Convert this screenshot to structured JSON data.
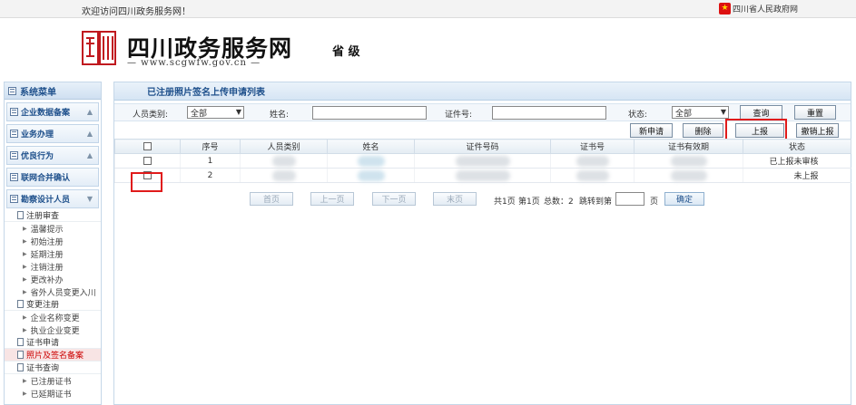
{
  "topbar": {
    "welcome": "欢迎访问四川政务服务网！",
    "gov_link": "四川省人民政府网",
    "emblem_icon": "national-emblem-icon"
  },
  "header": {
    "logo_chars": "四川",
    "site_name": "四川政务服务网",
    "site_url": "— www.scgwfw.gov.cn —",
    "level": "省 级"
  },
  "sidebar": {
    "title": "系统菜单",
    "sections": [
      {
        "label": "企业数据备案"
      },
      {
        "label": "业务办理"
      },
      {
        "label": "优良行为"
      },
      {
        "label": "联网合并确认"
      },
      {
        "label": "勘察设计人员"
      }
    ],
    "tree": [
      {
        "type": "group",
        "label": "注册审查"
      },
      {
        "type": "leaf",
        "label": "温馨提示"
      },
      {
        "type": "leaf",
        "label": "初始注册"
      },
      {
        "type": "leaf",
        "label": "延期注册"
      },
      {
        "type": "leaf",
        "label": "注销注册"
      },
      {
        "type": "leaf",
        "label": "更改补办"
      },
      {
        "type": "leaf",
        "label": "省外人员变更入川"
      },
      {
        "type": "group",
        "label": "变更注册"
      },
      {
        "type": "leaf",
        "label": "企业名称变更"
      },
      {
        "type": "leaf",
        "label": "执业企业变更"
      },
      {
        "type": "group",
        "label": "证书申请"
      },
      {
        "type": "group",
        "label": "照片及签名备案",
        "active": true
      },
      {
        "type": "group",
        "label": "证书查询"
      },
      {
        "type": "leaf",
        "label": "已注册证书"
      },
      {
        "type": "leaf",
        "label": "已延期证书"
      }
    ]
  },
  "panel": {
    "title": "已注册照片签名上传申请列表",
    "filters": {
      "person_type_label": "人员类别:",
      "person_type_value": "全部",
      "name_label": "姓名:",
      "name_value": "",
      "cert_no_label": "证件号:",
      "cert_no_value": "",
      "status_label": "状态:",
      "status_value": "全部"
    },
    "buttons": {
      "query": "查询",
      "reset": "重置",
      "new_apply": "新申请",
      "delete": "删除",
      "submit": "上报",
      "cancel_submit": "撤销上报"
    },
    "table": {
      "columns": [
        "",
        "序号",
        "人员类别",
        "姓名",
        "证件号码",
        "证书号",
        "证书有效期",
        "状态"
      ],
      "rows": [
        {
          "index": "1",
          "status": "已上报未审核"
        },
        {
          "index": "2",
          "status": "未上报"
        }
      ]
    },
    "pager": {
      "first": "首页",
      "prev": "上一页",
      "next": "下一页",
      "last": "末页",
      "total_pages": "共1页",
      "current_page": "第1页",
      "total_count": "总数：2",
      "jump_to": "跳转到第",
      "page_unit": "页",
      "confirm": "确定"
    }
  }
}
